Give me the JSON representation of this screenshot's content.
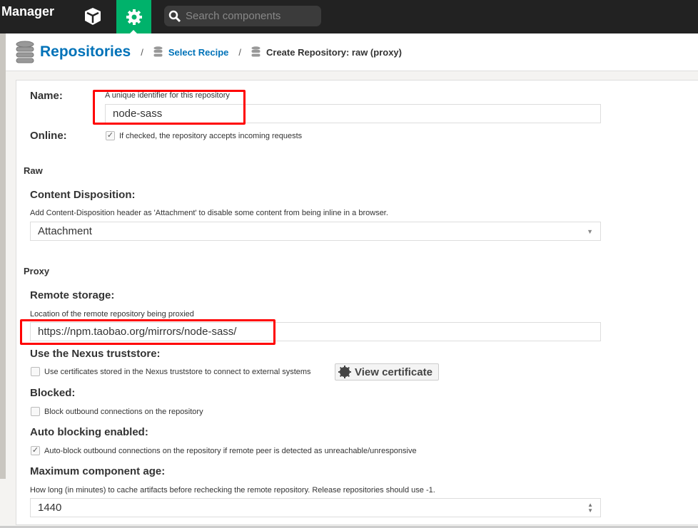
{
  "header": {
    "brand": "Manager",
    "search_placeholder": "Search components",
    "icons": [
      "cube-icon",
      "gear-icon",
      "search-icon"
    ],
    "accent": "#00b26b"
  },
  "breadcrumb": {
    "root": "Repositories",
    "step": "Select Recipe",
    "current": "Create Repository: raw (proxy)"
  },
  "form": {
    "name_label": "Name:",
    "name_help": "A unique identifier for this repository",
    "name_value": "node-sass",
    "online_label": "Online:",
    "online_help": "If checked, the repository accepts incoming requests",
    "online_checked": true,
    "section_raw": "Raw",
    "disposition_label": "Content Disposition:",
    "disposition_help": "Add Content-Disposition header as 'Attachment' to disable some content from being inline in a browser.",
    "disposition_value": "Attachment",
    "section_proxy": "Proxy",
    "remote_label": "Remote storage:",
    "remote_help": "Location of the remote repository being proxied",
    "remote_value": "https://npm.taobao.org/mirrors/node-sass/",
    "truststore_label": "Use the Nexus truststore:",
    "truststore_help": "Use certificates stored in the Nexus truststore to connect to external systems",
    "truststore_checked": false,
    "view_cert": "View certificate",
    "blocked_label": "Blocked:",
    "blocked_help": "Block outbound connections on the repository",
    "blocked_checked": false,
    "autoblock_label": "Auto blocking enabled:",
    "autoblock_help": "Auto-block outbound connections on the repository if remote peer is detected as unreachable/unresponsive",
    "autoblock_checked": true,
    "maxage_label": "Maximum component age:",
    "maxage_help": "How long (in minutes) to cache artifacts before rechecking the remote repository. Release repositories should use -1.",
    "maxage_value": "1440"
  }
}
